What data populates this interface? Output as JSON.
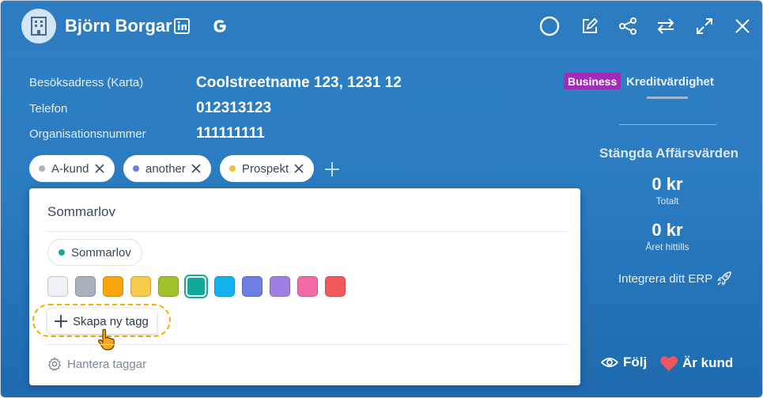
{
  "header": {
    "company_name": "Björn Borgar",
    "icons": [
      "building-icon",
      "linkedin-icon",
      "google-icon",
      "circle-status-icon",
      "edit-icon",
      "share-icon",
      "swap-icon",
      "expand-icon",
      "close-icon"
    ]
  },
  "info": {
    "rows": [
      {
        "label": "Besöksadress (Karta)",
        "value": "Coolstreetname 123, 1231 12"
      },
      {
        "label": "Telefon",
        "value": "012313123"
      },
      {
        "label": "Organisationsnummer",
        "value": "111111111"
      }
    ]
  },
  "tags": [
    {
      "name": "A-kund",
      "color": "#a9b3be"
    },
    {
      "name": "another",
      "color": "#6e7ee0"
    },
    {
      "name": "Prospekt",
      "color": "#f6c035"
    }
  ],
  "tag_popup": {
    "search_value": "Sommarlov",
    "preview_tag": {
      "name": "Sommarlov",
      "color": "#12a89a"
    },
    "swatches": [
      "#eef1f5",
      "#a8b1bd",
      "#fba50c",
      "#f8c94a",
      "#9fc32a",
      "#12a89a",
      "#12b1ef",
      "#6b7fe4",
      "#a07ee6",
      "#f26aa6",
      "#f25a5a"
    ],
    "selected_swatch_index": 5,
    "create_label": "Skapa ny tagg",
    "manage_label": "Hantera taggar"
  },
  "right_panel": {
    "badge": "Business",
    "credit_tab": "Kreditvärdighet",
    "closed_title": "Stängda Affärsvärden",
    "total_amount": "0 kr",
    "total_label": "Totalt",
    "ytd_amount": "0 kr",
    "ytd_label": "Året hittills",
    "erp_label": "Integrera ditt ERP",
    "follow_label": "Följ",
    "customer_label": "Är kund"
  },
  "colors": {
    "background": "#2a7bc0",
    "badge": "#a22bb9",
    "highlight_ring": "#f2b000",
    "heart": "#f0565f"
  }
}
